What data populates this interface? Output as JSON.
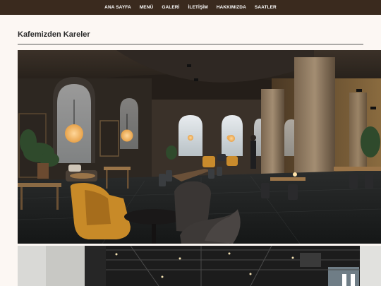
{
  "nav": {
    "items": [
      "ANA SAYFA",
      "MENÜ",
      "GALERİ",
      "İLETİŞİM",
      "HAKKIMIZDA",
      "SAATLER"
    ]
  },
  "main": {
    "title": "Kafemizden Kareler",
    "gallery": [
      {
        "name": "gallery-photo-cafe-interior"
      },
      {
        "name": "gallery-photo-industrial-interior"
      }
    ]
  },
  "colors": {
    "nav_bg": "#3a2a1e",
    "page_bg": "#fcf7f3",
    "title_text": "#2b2b2b"
  }
}
